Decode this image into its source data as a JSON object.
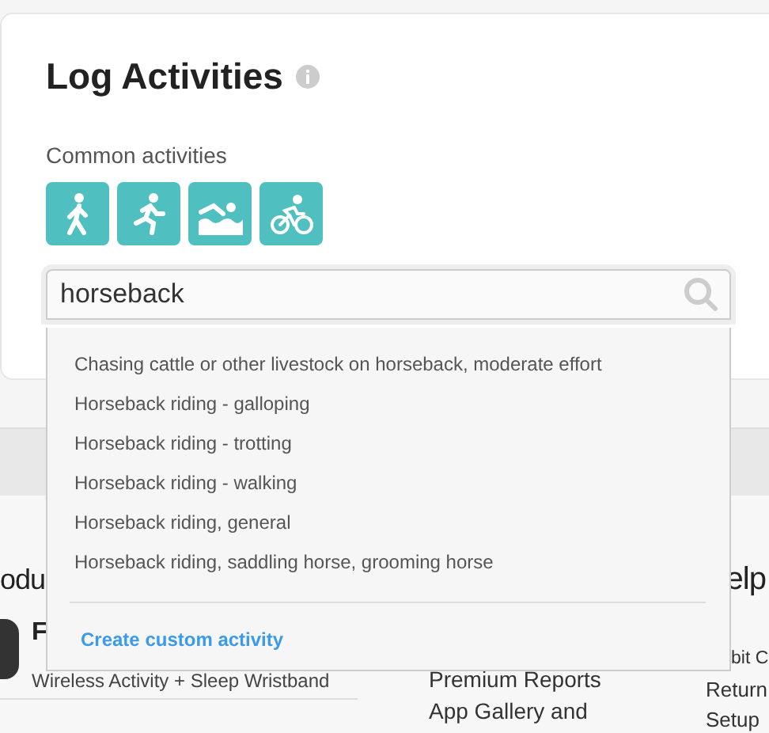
{
  "card": {
    "title": "Log Activities",
    "common_label": "Common activities",
    "activities": [
      {
        "kind": "walk"
      },
      {
        "kind": "run"
      },
      {
        "kind": "swim"
      },
      {
        "kind": "bike"
      }
    ],
    "search": {
      "value": "horseback"
    }
  },
  "suggestions": {
    "items": [
      "Chasing cattle or other livestock on horseback, moderate effort",
      "Horseback riding - galloping",
      "Horseback riding - trotting",
      "Horseback riding - walking",
      "Horseback riding, general",
      "Horseback riding, saddling horse, grooming horse"
    ],
    "create_link": "Create custom activity"
  },
  "footer": {
    "products_heading": "odu",
    "product_name": "F",
    "product_desc": "Wireless Activity + Sleep Wristband",
    "middle_links": [
      "Premium Reports",
      "App Gallery and"
    ],
    "help_heading": "elp",
    "help_links": [
      "bit C",
      "Return",
      "Setup"
    ]
  }
}
